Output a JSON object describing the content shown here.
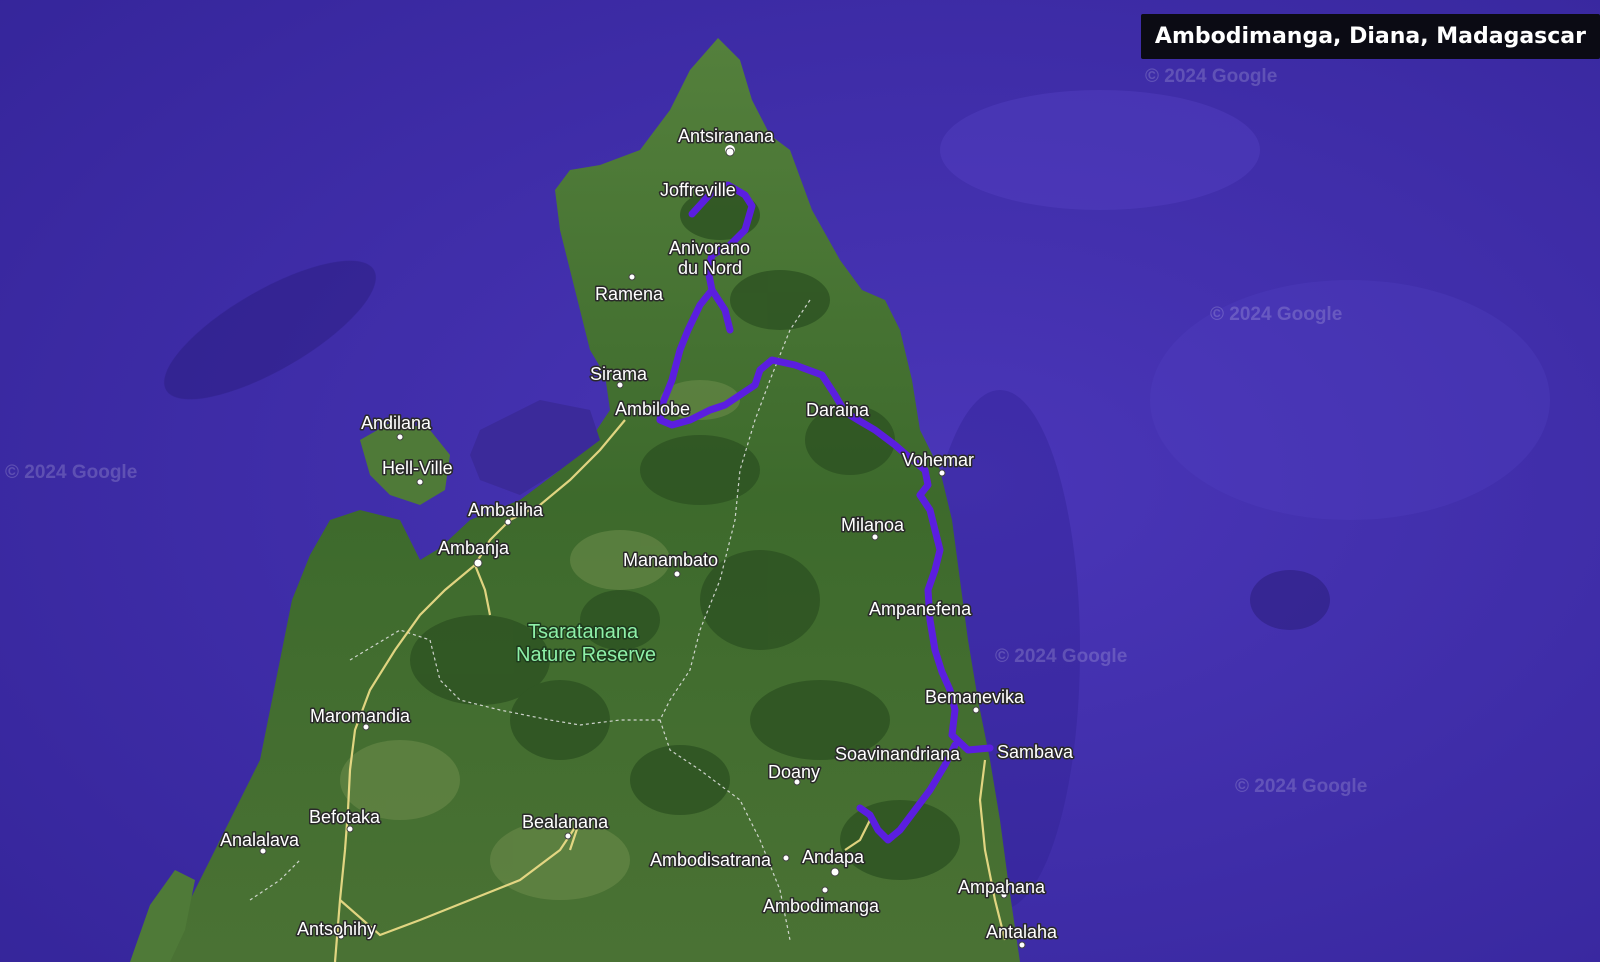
{
  "title": "Ambodimanga, Diana, Madagascar",
  "watermark": "© 2024 Google",
  "reserve": {
    "line1": "Tsaratanana",
    "line2": "Nature Reserve"
  },
  "colors": {
    "ocean": "#3b2a9a",
    "land": "#3e6b2e",
    "route": "#5b1ee0",
    "road": "#f2e08a"
  },
  "places": {
    "antsiranana": "Antsiranana",
    "joffreville": "Joffreville",
    "anivorano_1": "Anivorano",
    "anivorano_2": "du Nord",
    "ramena": "Ramena",
    "sirama": "Sirama",
    "ambilobe": "Ambilobe",
    "daraina": "Daraina",
    "vohemar": "Vohemar",
    "andilana": "Andilana",
    "hellville": "Hell-Ville",
    "ambaliha": "Ambaliha",
    "ambanja": "Ambanja",
    "manambato": "Manambato",
    "milanoa": "Milanoa",
    "ampanefena": "Ampanefena",
    "bemanevika": "Bemanevika",
    "soavinandriana": "Soavinandriana",
    "sambava": "Sambava",
    "maromandia": "Maromandia",
    "doany": "Doany",
    "befotaka": "Befotaka",
    "bealanana": "Bealanana",
    "analalava": "Analalava",
    "ambodisatrana": "Ambodisatrana",
    "andapa": "Andapa",
    "ampahana": "Ampahana",
    "ambodimanga": "Ambodimanga",
    "antsohihy": "Antsohihy",
    "antalaha": "Antalaha"
  }
}
